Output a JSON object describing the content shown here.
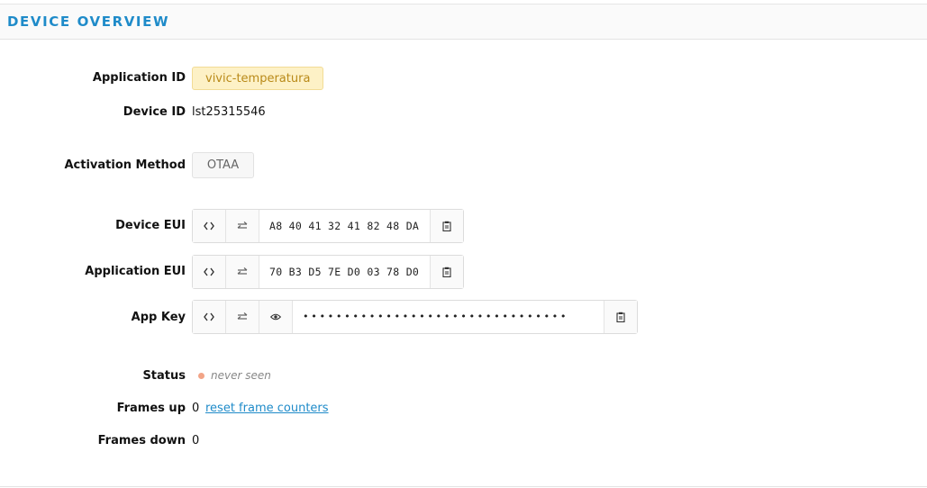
{
  "header": {
    "title": "DEVICE OVERVIEW"
  },
  "fields": {
    "application_id_label": "Application ID",
    "application_id": "vivic-temperatura",
    "device_id_label": "Device ID",
    "device_id": "lst25315546",
    "activation_method_label": "Activation Method",
    "activation_method": "OTAA",
    "device_eui_label": "Device EUI",
    "device_eui": "A8 40 41 32 41 82 48 DA",
    "application_eui_label": "Application EUI",
    "application_eui": "70 B3 D5 7E D0 03 78 D0",
    "app_key_label": "App Key",
    "app_key": "••••••••••••••••••••••••••••••••",
    "status_label": "Status",
    "status_value": "never seen",
    "frames_up_label": "Frames up",
    "frames_up": "0",
    "reset_link": "reset frame counters",
    "frames_down_label": "Frames down",
    "frames_down": "0"
  },
  "colors": {
    "accent": "#1f8bc9",
    "app_id_tag_bg": "#fdf1c6",
    "app_id_tag_text": "#b98a19",
    "status_dot": "#f2a487"
  },
  "icons": {
    "toggle_format": "code-brackets-icon",
    "swap_byte_order": "swap-arrows-icon",
    "reveal": "eye-icon",
    "copy": "clipboard-icon"
  }
}
